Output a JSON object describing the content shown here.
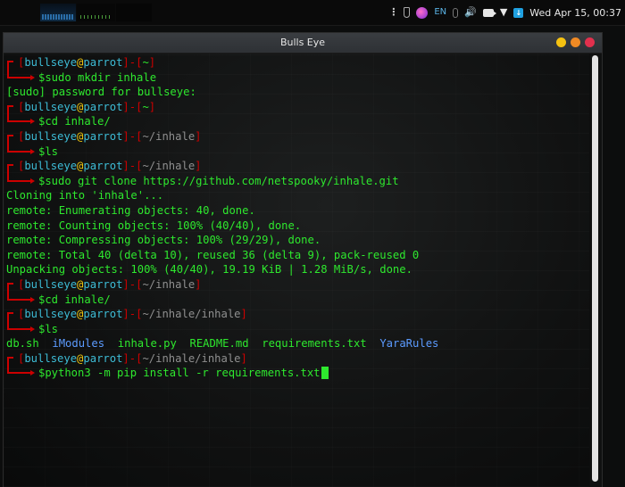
{
  "topbar": {
    "lang": "EN",
    "clock": "Wed Apr 15, 00:37",
    "icons": [
      "menu-dots-icon",
      "shield-icon",
      "parrot-app-icon",
      "language-indicator",
      "microphone-icon",
      "volume-icon",
      "camera-icon",
      "wifi-icon",
      "update-icon"
    ]
  },
  "window": {
    "title": "Bulls Eye",
    "buttons": [
      "minimize",
      "maximize",
      "close"
    ]
  },
  "prompt": {
    "user": "bullseye",
    "at": "@",
    "host": "parrot"
  },
  "lines": [
    {
      "type": "prompt",
      "path": "~",
      "cmd": "$sudo mkdir inhale"
    },
    {
      "type": "out",
      "text": "[sudo] password for bullseye:"
    },
    {
      "type": "prompt",
      "path": "~",
      "cmd": "$cd inhale/"
    },
    {
      "type": "prompt",
      "path": "~/inhale",
      "cmd": "$ls"
    },
    {
      "type": "prompt",
      "path": "~/inhale",
      "cmd": "$sudo git clone https://github.com/netspooky/inhale.git"
    },
    {
      "type": "out",
      "text": "Cloning into 'inhale'..."
    },
    {
      "type": "out",
      "text": "remote: Enumerating objects: 40, done."
    },
    {
      "type": "out",
      "text": "remote: Counting objects: 100% (40/40), done."
    },
    {
      "type": "out",
      "text": "remote: Compressing objects: 100% (29/29), done."
    },
    {
      "type": "out",
      "text": "remote: Total 40 (delta 10), reused 36 (delta 9), pack-reused 0"
    },
    {
      "type": "out",
      "text": "Unpacking objects: 100% (40/40), 19.19 KiB | 1.28 MiB/s, done."
    },
    {
      "type": "prompt",
      "path": "~/inhale",
      "cmd": "$cd inhale/"
    },
    {
      "type": "prompt",
      "path": "~/inhale/inhale",
      "cmd": "$ls"
    },
    {
      "type": "ls",
      "entries": [
        {
          "name": "db.sh",
          "kind": "file"
        },
        {
          "name": "iModules",
          "kind": "dir"
        },
        {
          "name": "inhale.py",
          "kind": "file"
        },
        {
          "name": "README.md",
          "kind": "file"
        },
        {
          "name": "requirements.txt",
          "kind": "file"
        },
        {
          "name": "YaraRules",
          "kind": "dir"
        }
      ]
    },
    {
      "type": "prompt",
      "path": "~/inhale/inhale",
      "cmd": "$python3 -m pip install -r requirements.txt",
      "cursor": true
    }
  ],
  "colors": {
    "text_green": "#2ee82e",
    "prompt_red": "#cc0000",
    "user_cyan": "#3dbcd6",
    "at_yellow": "#f2c80f",
    "dir_blue": "#5c9bff",
    "btn_yellow": "#f5c211",
    "btn_orange": "#f08a24",
    "btn_red": "#e2304d"
  }
}
